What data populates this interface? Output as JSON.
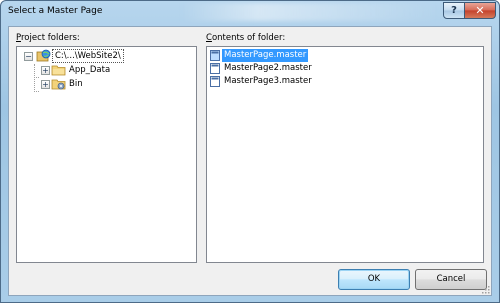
{
  "window": {
    "title": "Select a Master Page",
    "help_glyph": "?",
    "close_glyph": "✕"
  },
  "left": {
    "label_prefix": "",
    "label_accel": "P",
    "label_rest": "roject folders:",
    "tree": [
      {
        "label": "C:\\...\\WebSite2\\",
        "icon": "web-project-icon",
        "expander": "−",
        "selected": true
      },
      {
        "label": "App_Data",
        "icon": "folder-icon",
        "expander": "+"
      },
      {
        "label": "Bin",
        "icon": "folder-gear-icon",
        "expander": "+"
      }
    ]
  },
  "right": {
    "label_prefix": "",
    "label_accel": "C",
    "label_rest": "ontents of folder:",
    "files": [
      {
        "name": "MasterPage.master",
        "icon": "master-page-icon",
        "selected": true
      },
      {
        "name": "MasterPage2.master",
        "icon": "master-page-icon"
      },
      {
        "name": "MasterPage3.master",
        "icon": "master-page-icon"
      }
    ]
  },
  "buttons": {
    "ok": "OK",
    "cancel": "Cancel"
  },
  "colors": {
    "selection": "#3399ff",
    "title_gradient": "#b7d6ee",
    "client_bg": "#f0f0f0"
  }
}
